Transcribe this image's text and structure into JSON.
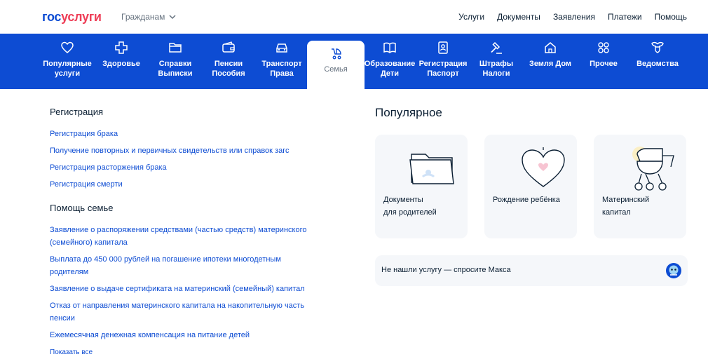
{
  "header": {
    "logo_part1": "гос",
    "logo_part2": "услуги",
    "audience": "Гражданам",
    "nav": [
      "Услуги",
      "Документы",
      "Заявления",
      "Платежи",
      "Помощь"
    ]
  },
  "categories": [
    {
      "l1": "Популярные",
      "l2": "услуги",
      "icon": "heart-icon"
    },
    {
      "l1": "Здоровье",
      "l2": "",
      "icon": "plus-icon"
    },
    {
      "l1": "Справки",
      "l2": "Выписки",
      "icon": "folder-icon"
    },
    {
      "l1": "Пенсии",
      "l2": "Пособия",
      "icon": "wallet-icon"
    },
    {
      "l1": "Транспорт",
      "l2": "Права",
      "icon": "car-icon"
    },
    {
      "l1": "Семья",
      "l2": "",
      "icon": "stroller-icon"
    },
    {
      "l1": "Образование",
      "l2": "Дети",
      "icon": "book-icon"
    },
    {
      "l1": "Регистрация",
      "l2": "Паспорт",
      "icon": "passport-icon"
    },
    {
      "l1": "Штрафы",
      "l2": "Налоги",
      "icon": "gavel-icon"
    },
    {
      "l1": "Земля Дом",
      "l2": "",
      "icon": "house-icon"
    },
    {
      "l1": "Прочее",
      "l2": "",
      "icon": "grid-icon"
    },
    {
      "l1": "Ведомства",
      "l2": "",
      "icon": "emblem-icon"
    }
  ],
  "registration": {
    "title": "Регистрация",
    "links": [
      "Регистрация брака",
      "Получение повторных и первичных свидетельств или справок загс",
      "Регистрация расторжения брака",
      "Регистрация смерти"
    ]
  },
  "family_help": {
    "title": "Помощь семье",
    "links": [
      {
        "l1": "Заявление о распоряжении средствами (частью средств) материнского",
        "l2": "(семейного) капитала"
      },
      {
        "l1": "Выплата до 450 000 рублей на погашение ипотеки многодетным",
        "l2": "родителям"
      },
      {
        "l1": "Заявление о выдаче сертификата на материнский (семейный) капитал",
        "l2": ""
      },
      {
        "l1": "Отказ от направления материнского капитала на накопительную часть",
        "l2": "пенсии"
      },
      {
        "l1": "Ежемесячная денежная компенсация на питание детей",
        "l2": ""
      }
    ],
    "show_all": "Показать все"
  },
  "popular": {
    "title": "Популярное",
    "cards": [
      {
        "l1": "Документы",
        "l2": "для родителей"
      },
      {
        "l1": "Рождение ребёнка",
        "l2": ""
      },
      {
        "l1": "Материнский",
        "l2": "капитал"
      }
    ]
  },
  "ask": {
    "text": "Не нашли услугу — спросите Макса"
  },
  "colors": {
    "brand_blue": "#0d4cd3",
    "brand_red": "#ee3f58",
    "card_bg": "#f5f7fa"
  }
}
